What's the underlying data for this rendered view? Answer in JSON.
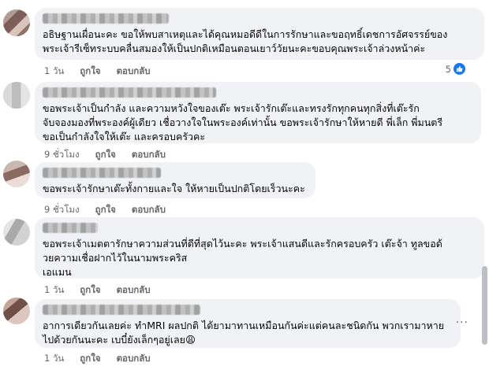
{
  "comments": [
    {
      "text": "อธิษฐานเผื่อนะคะ ขอให้พบสาเหตุและได้คุณหมอดีดีในการรักษาและขอฤทธิ์เดชการอัศจรรย์ของ\nพระเจ้ารีเซ็ทระบบคลื่นสมองให้เป็นปกติเหมือนตอนเยาว์วัยนะคะขอบคุณพระเจ้าล่วงหน้าค่ะ",
      "time": "1 วัน",
      "like": "ถูกใจ",
      "reply": "ตอบกลับ",
      "reactions": "5"
    },
    {
      "text": "ขอพระเจ้าเป็นกำลัง และความหวังใจของเต๊ะ พระเจ้ารักเต๊ะและทรงรักทุกคนทุกสิ่งที่เต๊ะรัก\nจับจองมองที่พระองค์ผู้เดียว เชื่อวางใจในพระองค์เท่านั้น ขอพระเจ้ารักษาให้หายดี พี่เล็ก พี่มนตรี\nขอเป็นกำลังใจให้เต๊ะ และครอบครัวคะ",
      "time": "9 ชั่วโมง",
      "like": "ถูกใจ",
      "reply": "ตอบกลับ"
    },
    {
      "text": "ขอพระเจ้ารักษาเต๊ะทั้งกายและใจ ให้หายเป็นปกติโดยเร็วนะคะ",
      "time": "9 ชั่วโมง",
      "like": "ถูกใจ",
      "reply": "ตอบกลับ"
    },
    {
      "text": "ขอพระเจ้าเมตตารักษาความส่วนที่ดีที่สุดไว้นะคะ พระเจ้าแสนดีและรักครอบครัว เต๊ะจ้า ทูลขอด้\nวยความเชื่อฝากไว้ในนามพระคริส\nเอแมน",
      "time": "1 วัน",
      "like": "ถูกใจ",
      "reply": "ตอบกลับ"
    },
    {
      "text": "อาการเดียวกันเลยค่ะ ทำMRI ผลปกติ ได้ยามาทานเหมือนกันค่ะแต่คนละชนิดกัน พวกเรามาหาย\nไปด้วยกันนะคะ เบบี๋ยังเล็กๆอยู่เลย😩",
      "time": "1 วัน",
      "like": "ถูกใจ",
      "reply": "ตอบกลับ"
    }
  ],
  "icons": {
    "like": "thumbs-up-icon",
    "more": "more-options-icon"
  },
  "colors": {
    "bubble": "#f0f2f5",
    "meta_text": "#65676b",
    "like_blue": "#1877f2"
  }
}
